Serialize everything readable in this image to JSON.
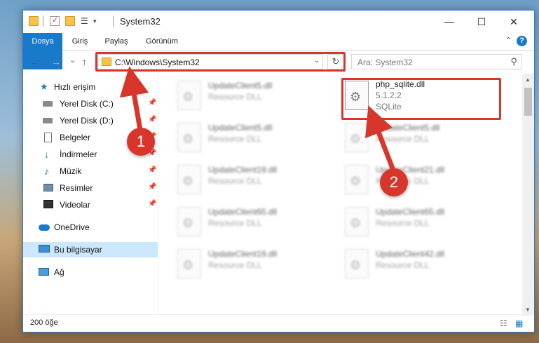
{
  "window": {
    "title": "System32",
    "minimize_glyph": "—",
    "maximize_glyph": "☐",
    "close_glyph": "✕"
  },
  "ribbon": {
    "tabs": [
      "Dosya",
      "Giriş",
      "Paylaş",
      "Görünüm"
    ],
    "help_glyph": "?",
    "collapse_glyph": "⌃"
  },
  "nav": {
    "back_glyph": "←",
    "forward_glyph": "→",
    "recent_glyph": "⌄",
    "up_glyph": "↑",
    "address": "C:\\Windows\\System32",
    "address_dropdown_glyph": "⌄",
    "refresh_glyph": "↻",
    "search_placeholder": "Ara: System32",
    "search_glyph": "⚲"
  },
  "sidebar": {
    "items": [
      {
        "label": "Hızlı erişim",
        "icon": "star-icon",
        "pinned": false
      },
      {
        "label": "Yerel Disk (C:)",
        "icon": "drive-icon",
        "pinned": true
      },
      {
        "label": "Yerel Disk (D:)",
        "icon": "drive-icon",
        "pinned": true
      },
      {
        "label": "Belgeler",
        "icon": "document-icon",
        "pinned": true
      },
      {
        "label": "İndirmeler",
        "icon": "download-icon",
        "pinned": true
      },
      {
        "label": "Müzik",
        "icon": "music-icon",
        "pinned": true
      },
      {
        "label": "Resimler",
        "icon": "picture-icon",
        "pinned": true
      },
      {
        "label": "Videolar",
        "icon": "video-icon",
        "pinned": true
      },
      {
        "label": "OneDrive",
        "icon": "cloud-icon",
        "pinned": false
      },
      {
        "label": "Bu bilgisayar",
        "icon": "computer-icon",
        "pinned": false,
        "selected": true
      },
      {
        "label": "Ağ",
        "icon": "network-icon",
        "pinned": false
      }
    ],
    "pin_glyph": "📌"
  },
  "files": {
    "highlighted": {
      "name": "php_sqlite.dll",
      "version": "5.1.2.2",
      "description": "SQLite"
    },
    "left_column": [
      {
        "name": "UpdateClient5.dll",
        "type": "Resource DLL"
      },
      {
        "name": "UpdateClient5.dll",
        "type": "Resource DLL"
      },
      {
        "name": "UpdateClient19.dll",
        "type": "Resource DLL"
      },
      {
        "name": "UpdateClient65.dll",
        "type": "Resource DLL"
      },
      {
        "name": "UpdateClient19.dll",
        "type": "Resource DLL"
      }
    ],
    "right_column": [
      {
        "name": "UpdateClient5.dll",
        "type": "Resource DLL"
      },
      {
        "name": "UpdateClient21.dll",
        "type": "Resource DLL"
      },
      {
        "name": "UpdateClient65.dll",
        "type": "Resource DLL"
      },
      {
        "name": "UpdateClient42.dll",
        "type": "Resource DLL"
      }
    ],
    "gear_glyph": "⚙"
  },
  "status": {
    "item_count": "200 öğe",
    "details_view_glyph": "☷",
    "large_icons_glyph": "▦"
  },
  "callouts": [
    "1",
    "2"
  ],
  "colors": {
    "accent": "#1979ca",
    "highlight": "#d9362b",
    "selection": "#cce8ff"
  }
}
